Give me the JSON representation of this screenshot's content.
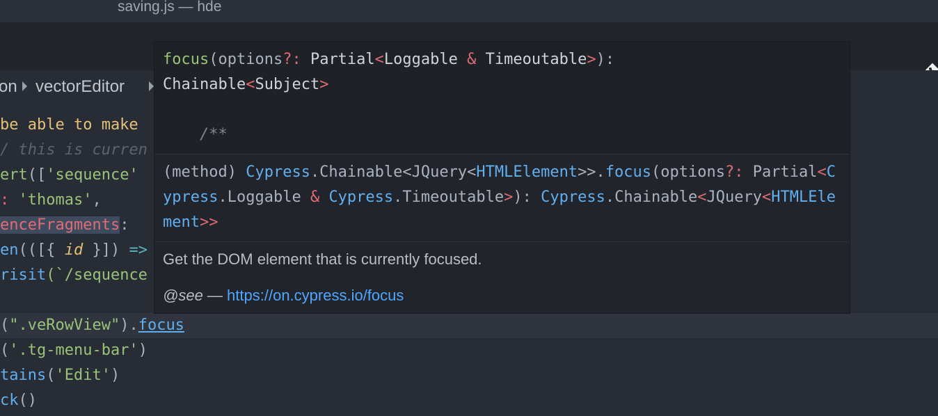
{
  "window": {
    "title": "saving.js — hde"
  },
  "breadcrumb": {
    "items": [
      "on",
      "vectorEditor"
    ]
  },
  "editor": {
    "lines": [
      {
        "parts": [
          "be able to make"
        ]
      },
      {
        "parts": [
          "/ this is curren"
        ]
      },
      {
        "parts": [
          "ert",
          "([",
          "'sequence'"
        ]
      },
      {
        "parts": [
          ": ",
          "'thomas'",
          ","
        ]
      },
      {
        "parts": [
          "enceFragments",
          ":"
        ]
      },
      {
        "parts": [
          "en",
          "(([{ ",
          "id",
          " }]) ",
          "=>"
        ]
      },
      {
        "parts": [
          "risit",
          "(`/sequence"
        ]
      },
      {
        "parts": [
          ""
        ]
      },
      {
        "parts": [
          "(",
          "\".veRowView\"",
          ").",
          "focus"
        ]
      },
      {
        "parts": [
          "(",
          "'.tg-menu-bar'",
          ")"
        ]
      },
      {
        "parts": [
          "tains",
          "(",
          "'Edit'",
          ")"
        ]
      },
      {
        "parts": [
          "ck",
          "()"
        ]
      }
    ]
  },
  "tooltip": {
    "signature": {
      "fn": "focus",
      "open": "(options",
      "q": "?:",
      "partial": " Partial",
      "lt": "<",
      "loggable": "Loggable ",
      "amp": "&",
      "timeoutable": " Timeoutable",
      "gt": ">",
      "close": "):",
      "chainable": "Chainable",
      "lt2": "<",
      "subject": "Subject",
      "gt2": ">",
      "comment": "/**"
    },
    "detail": {
      "p1": "(method) ",
      "cypress1": "Cypress",
      "p2": ".Chainable<JQuery<",
      "html1": "HTMLElement",
      "p3": ">>.",
      "focus": "focus",
      "p4": "(options",
      "q": "?:",
      "p5": " Partial",
      "lt": "<",
      "cypress2": "Cypress",
      "p6": ".Loggable ",
      "amp": "&",
      "p7": " ",
      "cypress3": "Cypress",
      "p8": ".Timeoutable",
      "gt": ">",
      "p9": "): ",
      "cypress4": "Cypress",
      "p10": ".Chainable",
      "lt2": "<",
      "p11": "JQuery",
      "lt3": "<",
      "html2": "HTMLElement",
      "gt2": ">>"
    },
    "doc": {
      "description": "Get the DOM element that is currently focused.",
      "see_tag": "@see",
      "see_dash": " — ",
      "see_link": "https://on.cypress.io/focus"
    }
  },
  "colors": {
    "background": "#282c34",
    "tooltip_bg": "#21252b",
    "accent_link": "#4fa6ff"
  },
  "icons": {
    "git": "git-diamond-icon"
  }
}
